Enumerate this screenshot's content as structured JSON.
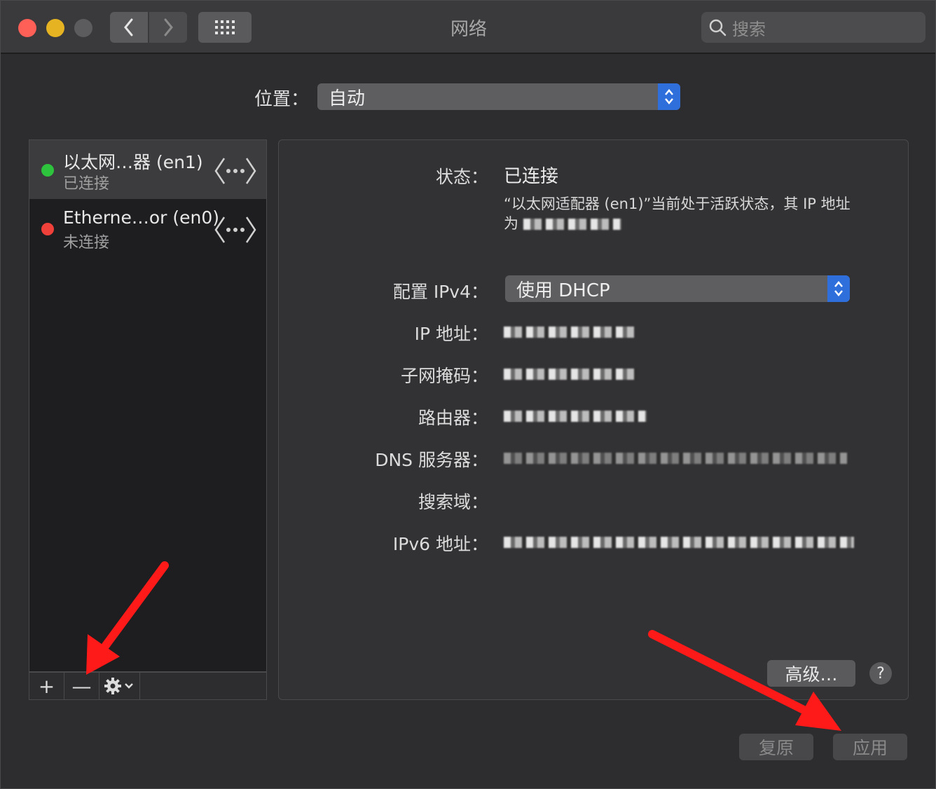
{
  "window": {
    "title": "网络",
    "search_placeholder": "搜索"
  },
  "location": {
    "label": "位置：",
    "value": "自动"
  },
  "interfaces": [
    {
      "name": "以太网…器 (en1)",
      "status": "已连接",
      "status_color": "#2ec33d",
      "selected": true,
      "icon": "ethernet-icon"
    },
    {
      "name": "Etherne…or (en0)",
      "status": "未连接",
      "status_color": "#f0403a",
      "selected": false,
      "icon": "ethernet-icon"
    }
  ],
  "list_toolbar": {
    "add": "+",
    "remove": "—",
    "action_icon": "gear-icon"
  },
  "details": {
    "status_label": "状态：",
    "status_value": "已连接",
    "status_description": "“以太网适配器 (en1)”当前处于活跃状态，其 IP 地址为",
    "config_label": "配置 IPv4：",
    "config_value": "使用 DHCP",
    "ip_label": "IP 地址：",
    "subnet_label": "子网掩码：",
    "router_label": "路由器：",
    "dns_label": "DNS 服务器：",
    "search_domain_label": "搜索域：",
    "ipv6_label": "IPv6 地址："
  },
  "buttons": {
    "advanced": "高级…",
    "help": "?",
    "revert": "复原",
    "apply": "应用"
  },
  "colors": {
    "accent": "#2f6fdc",
    "annotation_arrow": "#ff1a1a"
  }
}
